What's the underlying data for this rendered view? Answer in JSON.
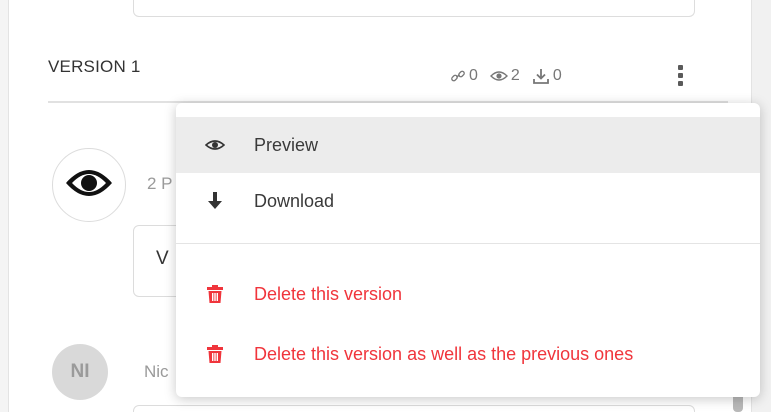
{
  "version": {
    "title": "VERSION 1",
    "stats": [
      {
        "icon": "link-icon",
        "value": "0"
      },
      {
        "icon": "eye-icon",
        "value": "2"
      },
      {
        "icon": "download-icon",
        "value": "0"
      }
    ]
  },
  "entry": {
    "meta": "2 P",
    "box_text": "V"
  },
  "user": {
    "initials": "NI",
    "name": "Nic"
  },
  "menu": {
    "items": [
      {
        "label": "Preview",
        "icon": "eye-icon",
        "hovered": true
      },
      {
        "label": "Download",
        "icon": "download-arrow-icon"
      },
      {
        "label": "Delete this version",
        "icon": "trash-icon",
        "danger": true
      },
      {
        "label": "Delete this version as well as the previous ones",
        "icon": "trash-icon",
        "danger": true
      }
    ]
  },
  "colors": {
    "danger": "#f0353c",
    "hover": "#ececec",
    "muted": "#9a9a9a"
  }
}
